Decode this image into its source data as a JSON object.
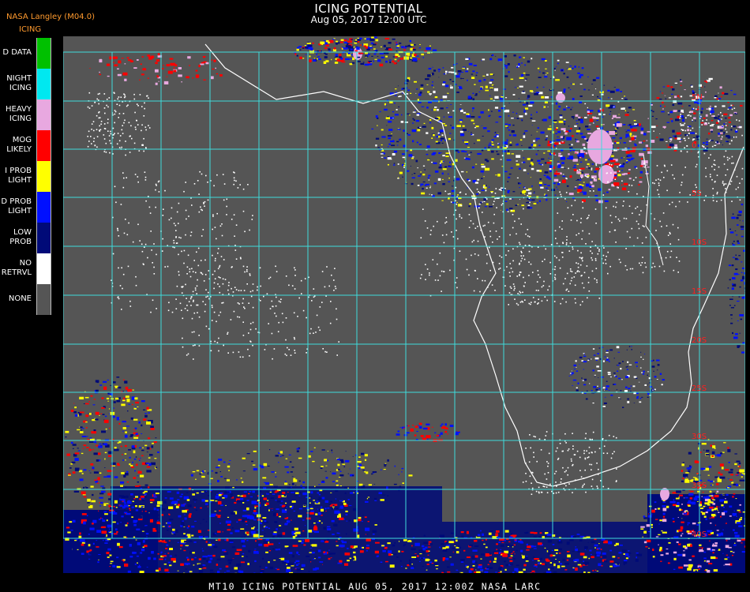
{
  "header": {
    "title": "ICING POTENTIAL",
    "subtitle": "Aug 05, 2017 12:00 UTC",
    "producer": "NASA Langley (M04.0)",
    "product": "ICING"
  },
  "legend": [
    {
      "label": "D DATA",
      "color": "#00c000"
    },
    {
      "label": "NIGHT\nICING",
      "color": "#00e8f0"
    },
    {
      "label": "HEAVY\nICING",
      "color": "#e8a8e0"
    },
    {
      "label": "MOG\nLIKELY",
      "color": "#ff0000"
    },
    {
      "label": "I PROB\nLIGHT",
      "color": "#ffff00"
    },
    {
      "label": "D PROB\nLIGHT",
      "color": "#0010ff"
    },
    {
      "label": "LOW\nPROB",
      "color": "#000a78"
    },
    {
      "label": "NO\nRETRVL",
      "color": "#ffffff"
    },
    {
      "label": "NONE",
      "color": "#555555"
    }
  ],
  "map": {
    "background": "#555555",
    "grid_color": "#3fdcdc",
    "label_color": "#ff2020",
    "lat_labels": [
      "5N",
      "0",
      "5S",
      "10S",
      "15S",
      "20S",
      "25S",
      "30S",
      "35S",
      "40S"
    ]
  },
  "footer": {
    "text": "MT10  ICING POTENTIAL   AUG 05, 2017 12:00Z   NASA LARC"
  }
}
